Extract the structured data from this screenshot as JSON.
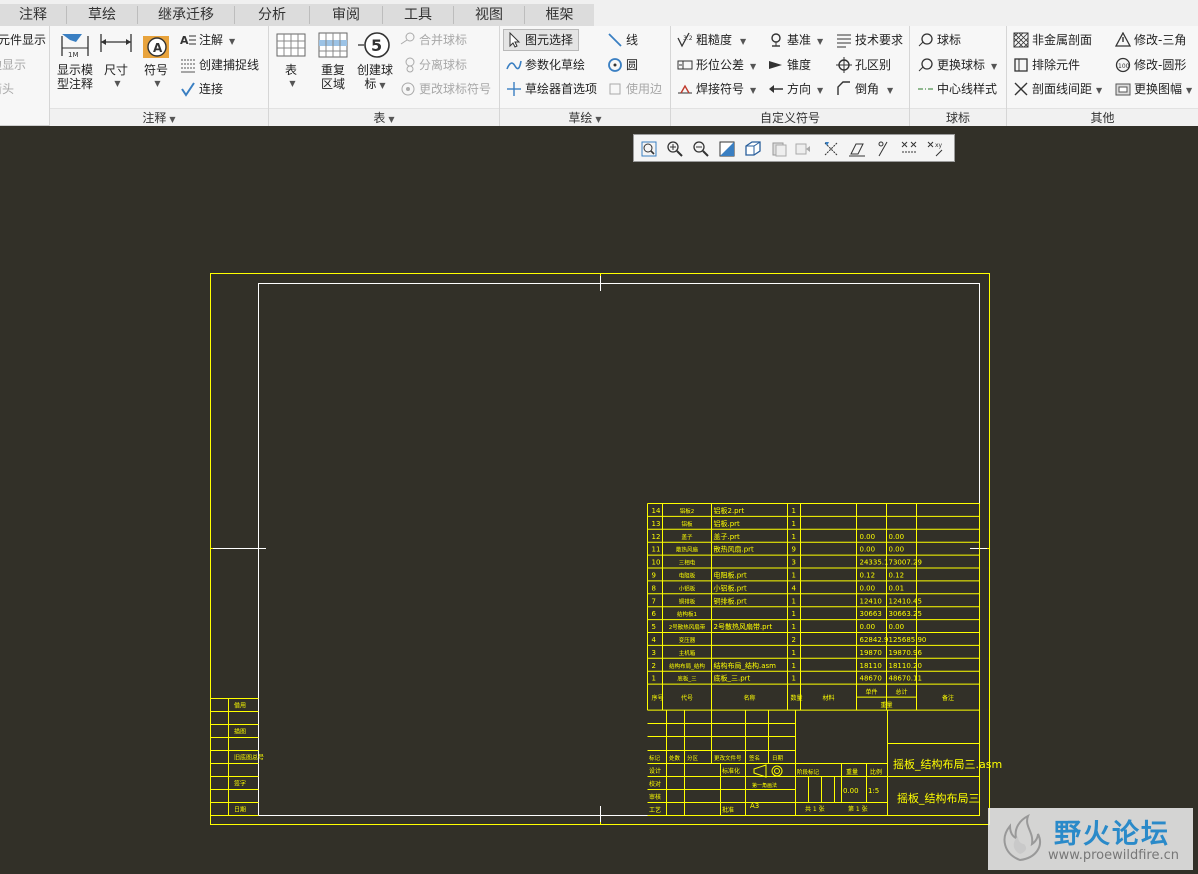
{
  "tabs": [
    {
      "label": "注释"
    },
    {
      "label": "草绘"
    },
    {
      "label": "继承迁移"
    },
    {
      "label": "分析"
    },
    {
      "label": "审阅"
    },
    {
      "label": "工具"
    },
    {
      "label": "视图"
    },
    {
      "label": "框架"
    }
  ],
  "ribbon": {
    "group0": {
      "items": [
        "元件显示",
        "边显示",
        "箭头"
      ]
    },
    "annotate": {
      "show_model_label": "显示模型注释",
      "show_model_line1": "显示模",
      "show_model_line2": "型注释",
      "dimension": "尺寸",
      "symbol": "符号",
      "note": "注解",
      "create_snap_line": "创建捕捉线",
      "connect": "连接",
      "group_label": "注释"
    },
    "table": {
      "table": "表",
      "repeat_region_1": "重复",
      "repeat_region_2": "区域",
      "create_balloon_1": "创建球",
      "create_balloon_2": "标",
      "merge_balloon": "合并球标",
      "split_balloon": "分离球标",
      "change_balloon_symbol": "更改球标符号",
      "group_label": "表"
    },
    "sketch": {
      "element_select": "图元选择",
      "parametric_sketch": "参数化草绘",
      "sketcher_prefs": "草绘器首选项",
      "line": "线",
      "circle": "圆",
      "use_edge": "使用边",
      "group_label": "草绘"
    },
    "custom_symbol": {
      "roughness": "粗糙度",
      "form_tolerance": "形位公差",
      "weld_symbol": "焊接符号",
      "datum": "基准",
      "taper": "锥度",
      "direction": "方向",
      "tech_req": "技术要求",
      "hole_distinguish": "孔区别",
      "chamfer": "倒角",
      "group_label": "自定义符号"
    },
    "balloon": {
      "balloon": "球标",
      "change_balloon": "更换球标",
      "centerline_style": "中心线样式",
      "group_label": "球标"
    },
    "other": {
      "nonmetal_section": "非金属剖面",
      "exclude_component": "排除元件",
      "section_line_spacing": "剖面线间距",
      "modify_triangle": "修改-三角",
      "modify_circle": "修改-圆形",
      "replace_frame": "更换图幅",
      "group_label": "其他"
    }
  },
  "drawing": {
    "bom_rows": [
      {
        "no": "14",
        "code": "铝板2",
        "name": "铝板2.prt",
        "qty": "1",
        "v1": "",
        "v2": ""
      },
      {
        "no": "13",
        "code": "铝板",
        "name": "铝板.prt",
        "qty": "1",
        "v1": "",
        "v2": ""
      },
      {
        "no": "12",
        "code": "盖子",
        "name": "盖子.prt",
        "qty": "1",
        "v1": "0.00",
        "v2": "0.00"
      },
      {
        "no": "11",
        "code": "散热风扇",
        "name": "散热风扇.prt",
        "qty": "9",
        "v1": "0.00",
        "v2": "0.00"
      },
      {
        "no": "10",
        "code": "三相电",
        "name": "",
        "qty": "3",
        "v1": "24335.1",
        "v2": "73007.29"
      },
      {
        "no": "9",
        "code": "电阻板",
        "name": "电阻板.prt",
        "qty": "1",
        "v1": "0.12",
        "v2": "0.12"
      },
      {
        "no": "8",
        "code": "小铝板",
        "name": "小铝板.prt",
        "qty": "4",
        "v1": "0.00",
        "v2": "0.01"
      },
      {
        "no": "7",
        "code": "铜排板",
        "name": "铜排板.prt",
        "qty": "1",
        "v1": "12410",
        "v2": "12410.45"
      },
      {
        "no": "6",
        "code": "结构板1",
        "name": "",
        "qty": "1",
        "v1": "30663",
        "v2": "30663.25"
      },
      {
        "no": "5",
        "code": "2号散热风扇带",
        "name": "2号散热风扇带.prt",
        "qty": "1",
        "v1": "0.00",
        "v2": "0.00"
      },
      {
        "no": "4",
        "code": "变压器",
        "name": "",
        "qty": "2",
        "v1": "62842.9",
        "v2": "125685.90"
      },
      {
        "no": "3",
        "code": "主机箱",
        "name": "",
        "qty": "1",
        "v1": "19870",
        "v2": "19870.96"
      },
      {
        "no": "2",
        "code": "结构布局_结构",
        "name": "结构布局_结构.asm",
        "qty": "1",
        "v1": "18110",
        "v2": "18110.20"
      },
      {
        "no": "1",
        "code": "底板_三",
        "name": "底板_三.prt",
        "qty": "1",
        "v1": "48670",
        "v2": "48670.11"
      }
    ],
    "bom_header": {
      "no": "序号",
      "code": "代号",
      "name": "名称",
      "qty": "数量",
      "material": "材料",
      "single": "单件",
      "total": "总计",
      "weight": "重量",
      "remark": "备注"
    },
    "left_strip": [
      "借用",
      "描图",
      "旧底图总号",
      "签字",
      "日期"
    ],
    "title_block": {
      "title_asm": "摇板_结构布局三.asm",
      "title_name": "摇板_结构布局三",
      "weight": "0.00",
      "scale": "1:5",
      "sheet_size": "A3",
      "mark_label": "阶段标记",
      "weight_label": "重量",
      "scale_label": "比例",
      "sheet_total": "共 1 张",
      "sheet_no": "第 1 张",
      "projection": "第一角画法",
      "row_labels": [
        "标记",
        "处数",
        "分区",
        "更改文件号",
        "签名",
        "日期"
      ],
      "sign_labels": [
        "设计",
        "校对",
        "审核",
        "工艺",
        "批准"
      ],
      "std_label": "标准化"
    }
  },
  "watermark": {
    "title": "野火论坛",
    "url": "www.proewildfire.cn"
  }
}
